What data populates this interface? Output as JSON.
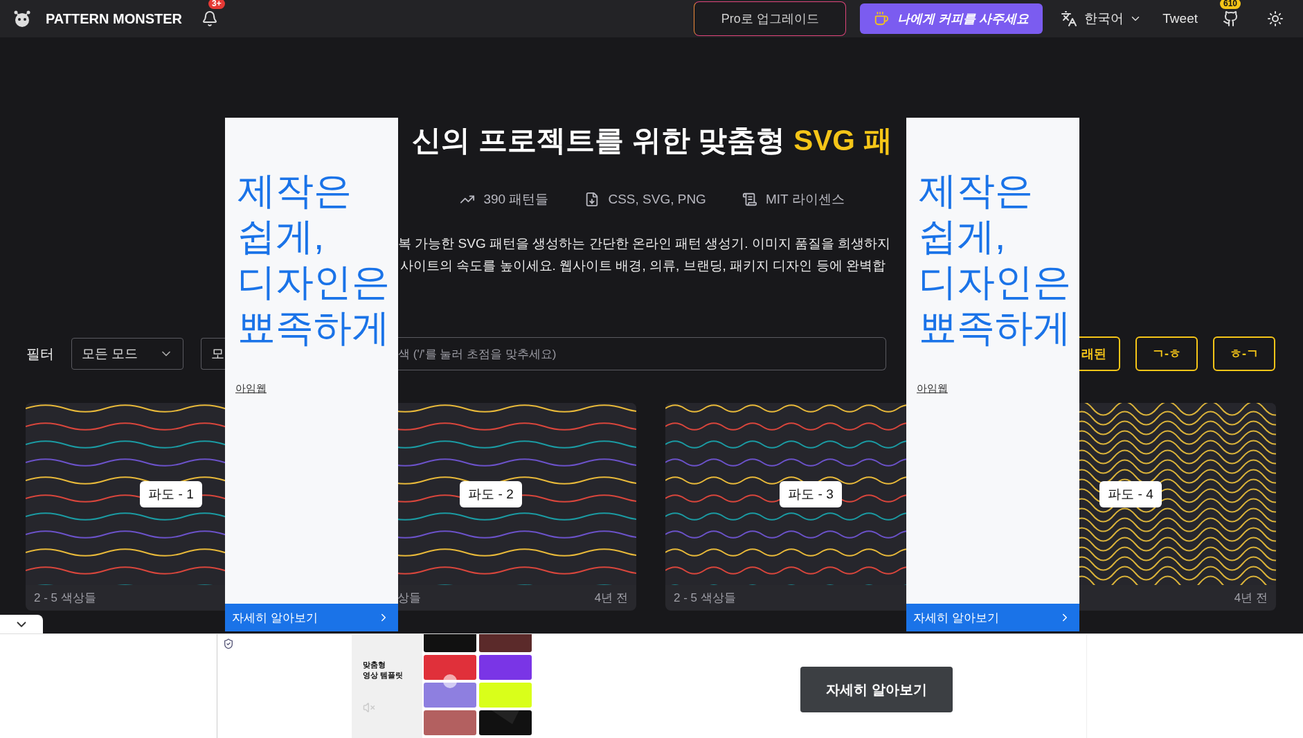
{
  "navbar": {
    "brand": "PATTERN MONSTER",
    "notification_badge": "3+",
    "upgrade_button": "Pro로 업그레이드",
    "coffee_button": "나에게 커피를 사주세요",
    "language": "한국어",
    "tweet": "Tweet",
    "github_stars": "610"
  },
  "hero": {
    "title": "신의 프로젝트를 위한 맞춤형 ",
    "title_highlight": "SVG 패",
    "stats": [
      {
        "kind": "trend",
        "label": "390 패턴들"
      },
      {
        "kind": "file",
        "label": "CSS, SVG, PNG"
      },
      {
        "kind": "license",
        "label": "MIT 라이센스"
      }
    ],
    "description": [
      "복 가능한 SVG 패턴을 생성하는 간단한 온라인 패턴 생성기. 이미지 품질을 희생하지",
      "사이트의 속도를 높이세요. 웹사이트 배경, 의류, 브랜딩, 패키지 디자인 등에 완벽합"
    ]
  },
  "filters": {
    "label": "필터",
    "mode_select": "모든 모드",
    "second_select": "모",
    "search_placeholder": "색 ('/'를 눌러 초점을 맞추세요)",
    "sort_buttons": [
      "래된",
      "ㄱ-ㅎ",
      "ㅎ-ㄱ"
    ]
  },
  "patterns": [
    {
      "name": "파도 - 1",
      "kind": "wide",
      "footer_left": "2 - 5 색상들"
    },
    {
      "name": "파도 - 2",
      "kind": "wide",
      "footer_left": "상들",
      "footer_right": "4년 전"
    },
    {
      "name": "파도 - 3",
      "kind": "tight",
      "footer_left": "2 - 5 색상들"
    },
    {
      "name": "파도 - 4",
      "kind": "dense",
      "footer_right": "4년 전"
    }
  ],
  "side_ads": [
    {
      "headline": [
        "제작은",
        "쉽게,",
        "디자인은",
        "뾰족하게"
      ],
      "advertiser": "아임웹",
      "cta": "자세히 알아보기"
    },
    {
      "headline": [
        "제작은",
        "쉽게,",
        "디자인은",
        "뾰족하게"
      ],
      "advertiser": "아임웹",
      "cta": "자세히 알아보기"
    }
  ],
  "bottom_ad": {
    "caption": [
      "맞춤형",
      "영상 템플릿"
    ],
    "cta": "자세히 알아보기"
  }
}
